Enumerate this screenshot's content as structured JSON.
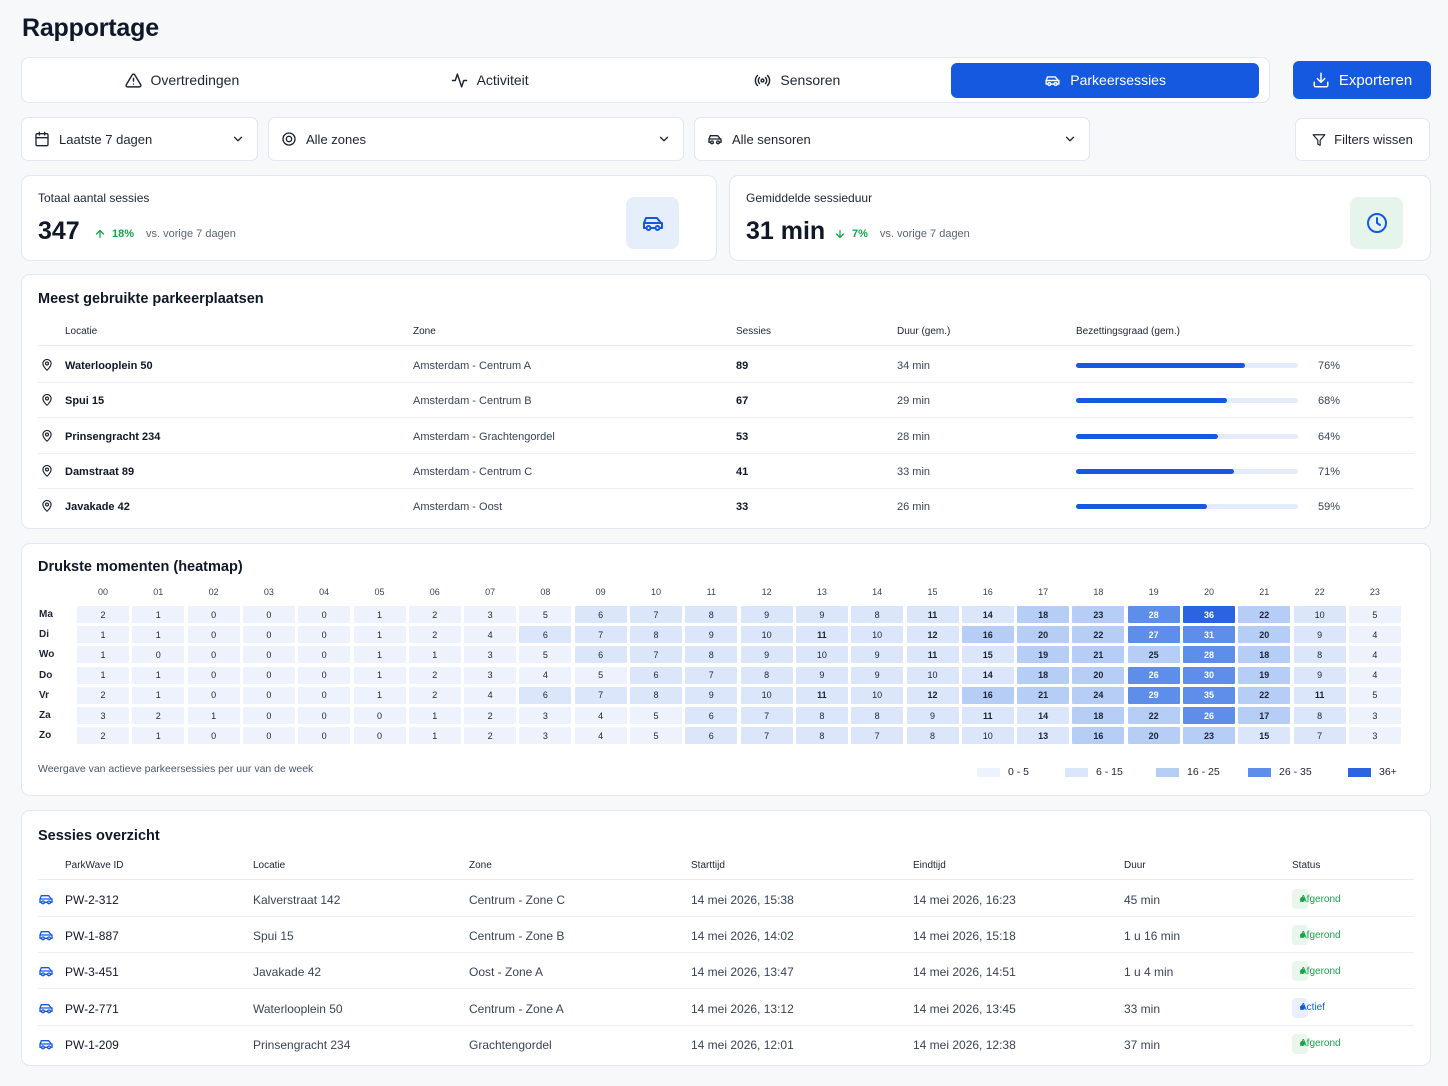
{
  "page": {
    "title": "Rapportage"
  },
  "tabs": [
    {
      "label": "Overtredingen",
      "icon": "warning-icon",
      "active": false
    },
    {
      "label": "Activiteit",
      "icon": "activity-icon",
      "active": false
    },
    {
      "label": "Sensoren",
      "icon": "sensor-icon",
      "active": false
    },
    {
      "label": "Parkeersessies",
      "icon": "car-icon",
      "active": true
    }
  ],
  "export_label": "Exporteren",
  "filters": {
    "period": "Laatste 7 dagen",
    "zones": "Alle zones",
    "sensors": "Alle sensoren",
    "clear_label": "Filters wissen"
  },
  "stats": {
    "total": {
      "label": "Totaal aantal sessies",
      "value": "347",
      "change": "18%",
      "direction": "up",
      "compare": "vs. vorige 7 dagen"
    },
    "duration": {
      "label": "Gemiddelde sessieduur",
      "value": "31 min",
      "change": "7%",
      "direction": "down",
      "compare": "vs. vorige 7 dagen"
    }
  },
  "top_locations": {
    "title": "Meest gebruikte parkeerplaatsen",
    "columns": [
      "Locatie",
      "Zone",
      "Sessies",
      "Duur (gem.)",
      "Bezettingsgraad (gem.)"
    ],
    "rows": [
      {
        "location": "Waterlooplein 50",
        "zone": "Amsterdam - Centrum A",
        "sessions": "89",
        "duration": "34 min",
        "occupancy": 76,
        "occupancy_label": "76%"
      },
      {
        "location": "Spui 15",
        "zone": "Amsterdam - Centrum B",
        "sessions": "67",
        "duration": "29 min",
        "occupancy": 68,
        "occupancy_label": "68%"
      },
      {
        "location": "Prinsengracht 234",
        "zone": "Amsterdam - Grachtengordel",
        "sessions": "53",
        "duration": "28 min",
        "occupancy": 64,
        "occupancy_label": "64%"
      },
      {
        "location": "Damstraat 89",
        "zone": "Amsterdam - Centrum C",
        "sessions": "41",
        "duration": "33 min",
        "occupancy": 71,
        "occupancy_label": "71%"
      },
      {
        "location": "Javakade 42",
        "zone": "Amsterdam - Oost",
        "sessions": "33",
        "duration": "26 min",
        "occupancy": 59,
        "occupancy_label": "59%"
      }
    ]
  },
  "heatmap": {
    "title": "Drukste momenten (heatmap)",
    "hours": [
      "00",
      "01",
      "02",
      "03",
      "04",
      "05",
      "06",
      "07",
      "08",
      "09",
      "10",
      "11",
      "12",
      "13",
      "14",
      "15",
      "16",
      "17",
      "18",
      "19",
      "20",
      "21",
      "22",
      "23"
    ],
    "days": [
      "Ma",
      "Di",
      "Wo",
      "Do",
      "Vr",
      "Za",
      "Zo"
    ],
    "values": [
      [
        2,
        1,
        0,
        0,
        0,
        1,
        2,
        3,
        5,
        6,
        7,
        8,
        9,
        9,
        8,
        11,
        14,
        18,
        23,
        28,
        36,
        22,
        10,
        5
      ],
      [
        1,
        1,
        0,
        0,
        0,
        1,
        2,
        4,
        6,
        7,
        8,
        9,
        10,
        11,
        10,
        12,
        16,
        20,
        22,
        27,
        31,
        20,
        9,
        4
      ],
      [
        1,
        0,
        0,
        0,
        0,
        1,
        1,
        3,
        5,
        6,
        7,
        8,
        9,
        10,
        9,
        11,
        15,
        19,
        21,
        25,
        28,
        18,
        8,
        4
      ],
      [
        1,
        1,
        0,
        0,
        0,
        1,
        2,
        3,
        4,
        5,
        6,
        7,
        8,
        9,
        9,
        10,
        14,
        18,
        20,
        26,
        30,
        19,
        9,
        4
      ],
      [
        2,
        1,
        0,
        0,
        0,
        1,
        2,
        4,
        6,
        7,
        8,
        9,
        10,
        11,
        10,
        12,
        16,
        21,
        24,
        29,
        35,
        22,
        11,
        5
      ],
      [
        3,
        2,
        1,
        0,
        0,
        0,
        1,
        2,
        3,
        4,
        5,
        6,
        7,
        8,
        8,
        9,
        11,
        14,
        18,
        22,
        26,
        17,
        8,
        3
      ],
      [
        2,
        1,
        0,
        0,
        0,
        0,
        1,
        2,
        3,
        4,
        5,
        6,
        7,
        8,
        7,
        8,
        10,
        13,
        16,
        20,
        23,
        15,
        7,
        3
      ]
    ],
    "note": "Weergave van actieve parkeersessies per uur van de week",
    "legend": [
      {
        "label": "0 - 5",
        "color": "#edf2fc"
      },
      {
        "label": "6 - 15",
        "color": "#dbe6fa"
      },
      {
        "label": "16 - 25",
        "color": "#b6cdf5"
      },
      {
        "label": "26 - 35",
        "color": "#5d8ee9"
      },
      {
        "label": "36+",
        "color": "#2a64e0"
      }
    ]
  },
  "sessions": {
    "title": "Sessies overzicht",
    "columns": [
      "ParkWave ID",
      "Locatie",
      "Zone",
      "Starttijd",
      "Eindtijd",
      "Duur",
      "Status"
    ],
    "rows": [
      {
        "id": "PW-2-312",
        "location": "Kalverstraat 142",
        "zone": "Centrum - Zone C",
        "start": "14 mei 2026, 15:38",
        "end": "14 mei 2026, 16:23",
        "duration": "45 min",
        "status": "Afgerond",
        "status_type": "done"
      },
      {
        "id": "PW-1-887",
        "location": "Spui 15",
        "zone": "Centrum - Zone B",
        "start": "14 mei 2026, 14:02",
        "end": "14 mei 2026, 15:18",
        "duration": "1 u 16 min",
        "status": "Afgerond",
        "status_type": "done"
      },
      {
        "id": "PW-3-451",
        "location": "Javakade 42",
        "zone": "Oost - Zone A",
        "start": "14 mei 2026, 13:47",
        "end": "14 mei 2026, 14:51",
        "duration": "1 u 4 min",
        "status": "Afgerond",
        "status_type": "done"
      },
      {
        "id": "PW-2-771",
        "location": "Waterlooplein 50",
        "zone": "Centrum - Zone A",
        "start": "14 mei 2026, 13:12",
        "end": "14 mei 2026, 13:45",
        "duration": "33 min",
        "status": "Actief",
        "status_type": "active"
      },
      {
        "id": "PW-1-209",
        "location": "Prinsengracht 234",
        "zone": "Grachtengordel",
        "start": "14 mei 2026, 12:01",
        "end": "14 mei 2026, 12:38",
        "duration": "37 min",
        "status": "Afgerond",
        "status_type": "done"
      }
    ]
  },
  "colors": {
    "accent": "#1559e0",
    "success": "#16a34a",
    "badge_done_bg": "#e8f6ec",
    "badge_active_bg": "#e8effd"
  }
}
